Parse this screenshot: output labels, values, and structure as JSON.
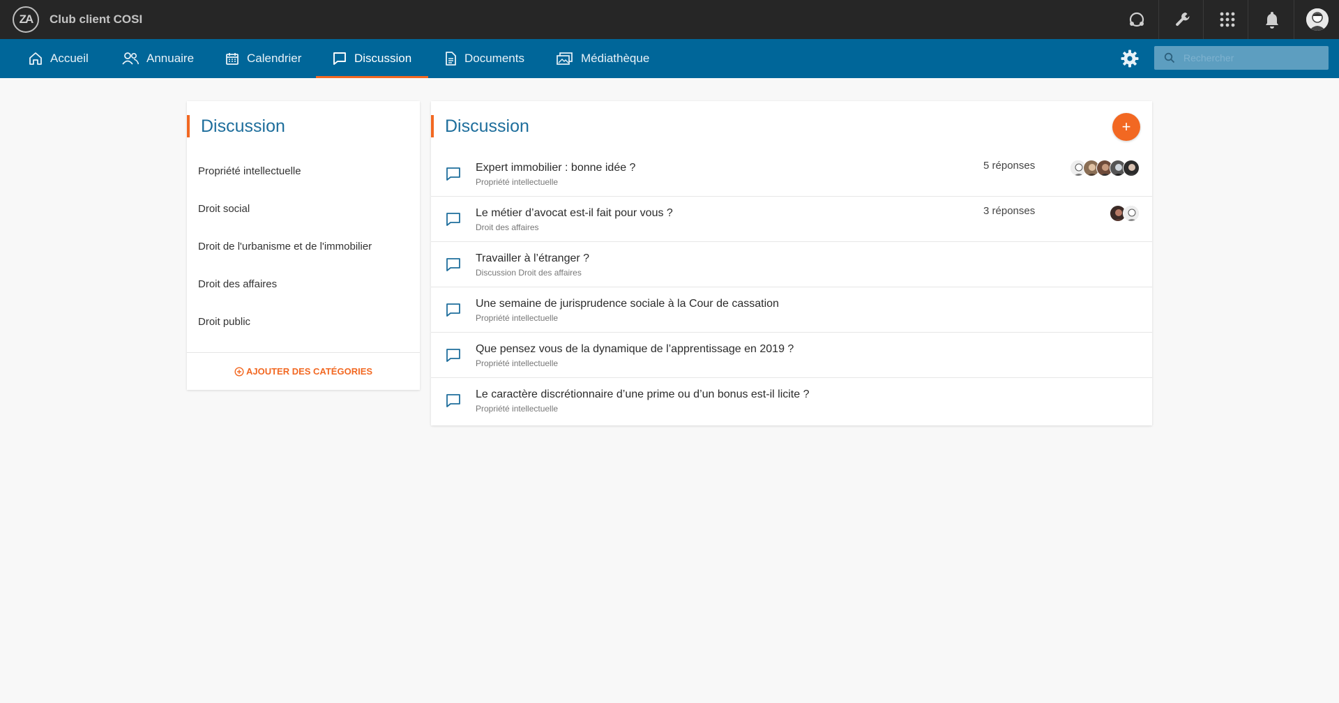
{
  "app": {
    "title": "Club client COSI",
    "logo_text": "ZA"
  },
  "top_icons": [
    "support-icon",
    "wrench-icon",
    "apps-grid-icon",
    "bell-icon",
    "user-avatar"
  ],
  "nav": {
    "items": [
      {
        "label": "Accueil",
        "icon": "home-icon"
      },
      {
        "label": "Annuaire",
        "icon": "users-icon"
      },
      {
        "label": "Calendrier",
        "icon": "calendar-icon"
      },
      {
        "label": "Discussion",
        "icon": "chat-icon",
        "active": true
      },
      {
        "label": "Documents",
        "icon": "document-icon"
      },
      {
        "label": "Médiathèque",
        "icon": "media-icon"
      }
    ],
    "search_placeholder": "Rechercher"
  },
  "sidebar": {
    "title": "Discussion",
    "categories": [
      "Propriété intellectuelle",
      "Droit social",
      "Droit de l'urbanisme et de l'immobilier",
      "Droit des affaires",
      "Droit public"
    ],
    "add_label": "AJOUTER DES CATÉGORIES"
  },
  "main": {
    "title": "Discussion",
    "add_button": "+",
    "topics": [
      {
        "title": "Expert immobilier : bonne idée ?",
        "category": "Propriété intellectuelle",
        "replies": "5 réponses",
        "avatars": 5
      },
      {
        "title": "Le métier d’avocat est-il fait pour vous ?",
        "category": "Droit des affaires",
        "replies": "3 réponses",
        "avatars": 2
      },
      {
        "title": "Travailler à l’étranger ?",
        "category": "Discussion Droit des affaires",
        "replies": "",
        "avatars": 0
      },
      {
        "title": "Une semaine de jurisprudence sociale à la Cour de cassation",
        "category": "Propriété intellectuelle",
        "replies": "",
        "avatars": 0
      },
      {
        "title": "Que pensez vous de la dynamique de l’apprentissage en 2019 ?",
        "category": "Propriété intellectuelle",
        "replies": "",
        "avatars": 0
      },
      {
        "title": "Le caractère discrétionnaire d’une prime ou d’un bonus est-il licite ?",
        "category": "Propriété intellectuelle",
        "replies": "",
        "avatars": 0
      }
    ]
  },
  "colors": {
    "topbar": "#262626",
    "nav": "#006699",
    "accent": "#f26822",
    "title_blue": "#1e6e9c",
    "background": "#f8f8f8"
  }
}
